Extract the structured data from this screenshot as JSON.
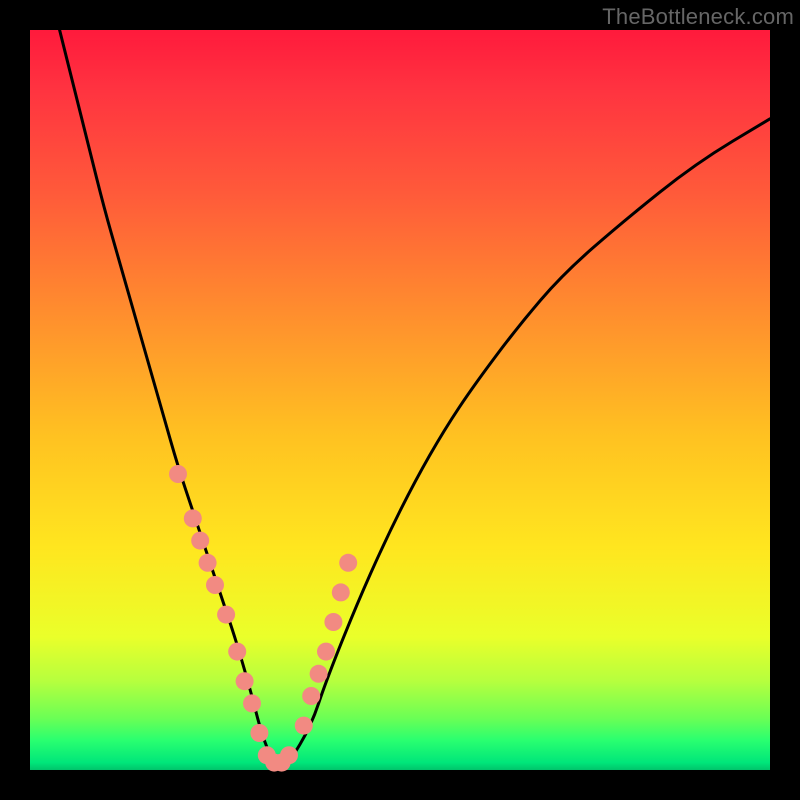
{
  "watermark": "TheBottleneck.com",
  "chart_data": {
    "type": "line",
    "title": "",
    "xlabel": "",
    "ylabel": "",
    "xlim": [
      0,
      100
    ],
    "ylim": [
      0,
      100
    ],
    "series": [
      {
        "name": "bottleneck-curve",
        "x": [
          4,
          6,
          8,
          10,
          12,
          14,
          16,
          18,
          20,
          22,
          24,
          26,
          28,
          30,
          31,
          32,
          33,
          34,
          35,
          38,
          40,
          44,
          48,
          52,
          56,
          60,
          66,
          72,
          80,
          90,
          100
        ],
        "values": [
          100,
          92,
          84,
          76,
          69,
          62,
          55,
          48,
          41,
          35,
          29,
          23,
          17,
          10,
          6,
          3,
          1,
          0,
          1,
          6,
          12,
          22,
          31,
          39,
          46,
          52,
          60,
          67,
          74,
          82,
          88
        ]
      }
    ],
    "markers": {
      "name": "highlighted-points",
      "color": "#f28a82",
      "radius_px": 9,
      "x": [
        20,
        22,
        23,
        24,
        25,
        26.5,
        28,
        29,
        30,
        31,
        32,
        33,
        34,
        35,
        37,
        38,
        39,
        40,
        41,
        42,
        43
      ],
      "values": [
        40,
        34,
        31,
        28,
        25,
        21,
        16,
        12,
        9,
        5,
        2,
        1,
        1,
        2,
        6,
        10,
        13,
        16,
        20,
        24,
        28
      ]
    },
    "background_gradient": {
      "orientation": "vertical",
      "stops": [
        {
          "pos": 0.0,
          "color": "#ff1a3c"
        },
        {
          "pos": 0.38,
          "color": "#ff8d2e"
        },
        {
          "pos": 0.7,
          "color": "#ffe61f"
        },
        {
          "pos": 0.93,
          "color": "#6bff55"
        },
        {
          "pos": 1.0,
          "color": "#00c46b"
        }
      ]
    }
  }
}
